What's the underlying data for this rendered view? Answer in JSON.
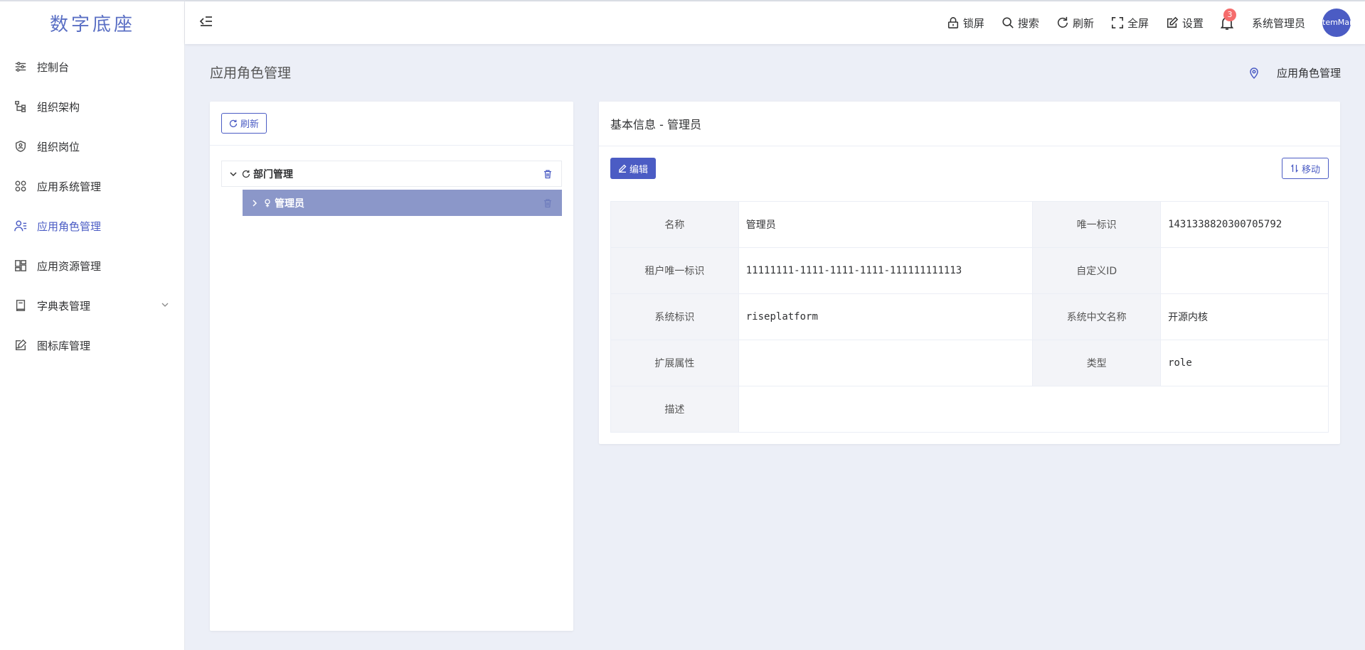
{
  "app": {
    "logo": "数字底座"
  },
  "sidebar": {
    "items": [
      {
        "label": "控制台",
        "icon": "sliders-icon"
      },
      {
        "label": "组织架构",
        "icon": "org-tree-icon"
      },
      {
        "label": "组织岗位",
        "icon": "shield-user-icon"
      },
      {
        "label": "应用系统管理",
        "icon": "grid-circles-icon"
      },
      {
        "label": "应用角色管理",
        "icon": "user-list-icon",
        "active": true
      },
      {
        "label": "应用资源管理",
        "icon": "dashboard-icon"
      },
      {
        "label": "字典表管理",
        "icon": "book-icon",
        "expandable": true
      },
      {
        "label": "图标库管理",
        "icon": "image-edit-icon"
      }
    ]
  },
  "header": {
    "lock_label": "锁屏",
    "search_label": "搜索",
    "refresh_label": "刷新",
    "fullscreen_label": "全屏",
    "settings_label": "设置",
    "notification_count": "3",
    "user_name": "系统管理员",
    "avatar_text": "temMan"
  },
  "page": {
    "title": "应用角色管理",
    "breadcrumb": "应用角色管理"
  },
  "tree_panel": {
    "refresh_label": "刷新",
    "nodes": [
      {
        "label": "部门管理",
        "expanded": true
      },
      {
        "label": "管理员",
        "selected": true
      }
    ]
  },
  "detail": {
    "title": "基本信息 - 管理员",
    "edit_label": "编辑",
    "move_label": "移动",
    "fields": {
      "name_label": "名称",
      "name_value": "管理员",
      "uid_label": "唯一标识",
      "uid_value": "1431338820300705792",
      "tenant_label": "租户唯一标识",
      "tenant_value": "11111111-1111-1111-1111-111111111113",
      "custom_id_label": "自定义ID",
      "custom_id_value": "",
      "sys_label": "系统标识",
      "sys_value": "riseplatform",
      "sys_cn_label": "系统中文名称",
      "sys_cn_value": "开源内核",
      "ext_label": "扩展属性",
      "ext_value": "",
      "type_label": "类型",
      "type_value": "role",
      "desc_label": "描述",
      "desc_value": ""
    }
  },
  "colors": {
    "accent": "#4b5cc4",
    "selected_node": "#8b97c9",
    "badge": "#f56c6c",
    "background": "#eceff7"
  }
}
